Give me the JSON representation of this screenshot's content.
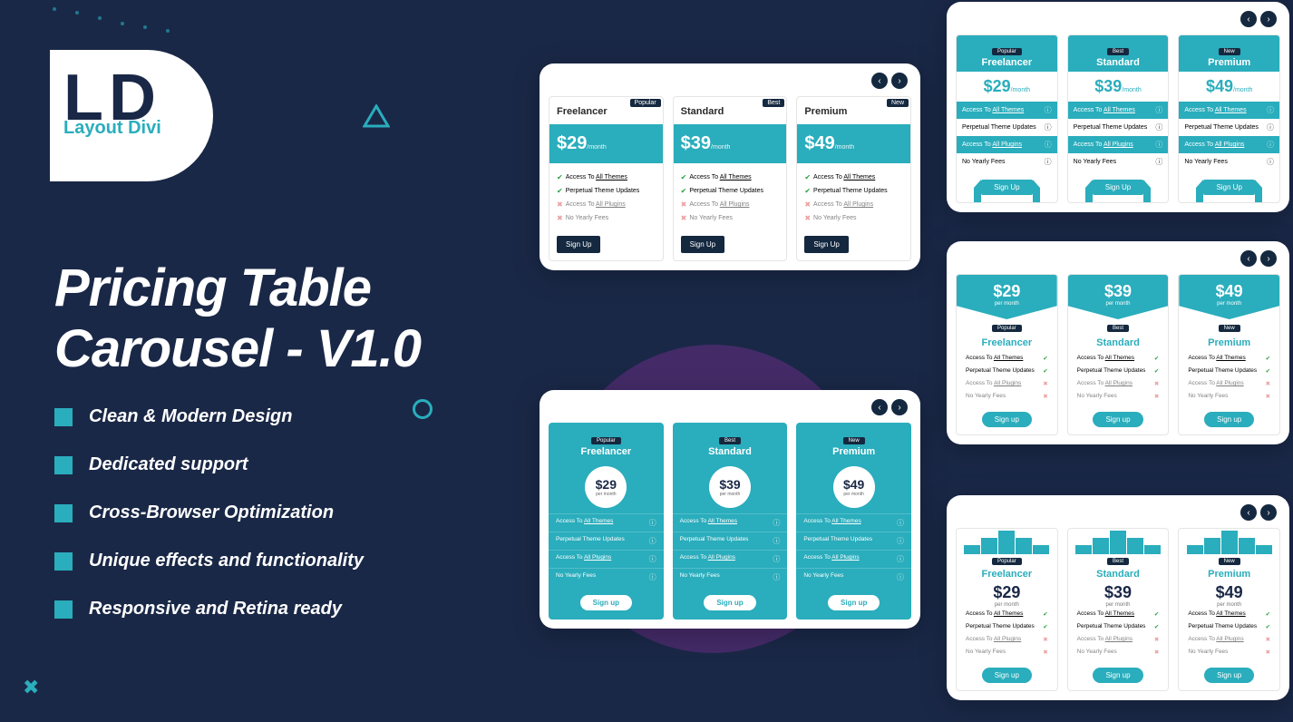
{
  "brand": {
    "name": "Layout Divi",
    "letter1": "L",
    "letter2": "D"
  },
  "title_line1": "Pricing Table",
  "title_line2": "Carousel - V1.0",
  "features": [
    "Clean & Modern Design",
    "Dedicated support",
    "Cross-Browser Optimization",
    "Unique effects and functionality",
    "Responsive and Retina ready"
  ],
  "nav": {
    "prev": "‹",
    "next": "›"
  },
  "plans": [
    {
      "badge": "Popular",
      "name": "Freelancer",
      "price": "$29",
      "period": "/month",
      "period_alt": "per month"
    },
    {
      "badge": "Best",
      "name": "Standard",
      "price": "$39",
      "period": "/month",
      "period_alt": "per month"
    },
    {
      "badge": "New",
      "name": "Premium",
      "price": "$49",
      "period": "/month",
      "period_alt": "per month"
    }
  ],
  "plan_features": [
    {
      "label_pre": "Access To ",
      "label_link": "All Themes",
      "ok": true
    },
    {
      "label": "Perpetual Theme Updates",
      "ok": true
    },
    {
      "label_pre": "Access To ",
      "label_link": "All Plugins",
      "ok": false
    },
    {
      "label": "No Yearly Fees",
      "ok": false
    }
  ],
  "cta": {
    "signup": "Sign Up",
    "signup_lc": "Sign up"
  },
  "colors": {
    "teal": "#2aadbc",
    "navy": "#1a2847",
    "dark": "#14283f"
  },
  "icons": {
    "check": "✔",
    "cross": "✖",
    "info": "ⓘ"
  }
}
